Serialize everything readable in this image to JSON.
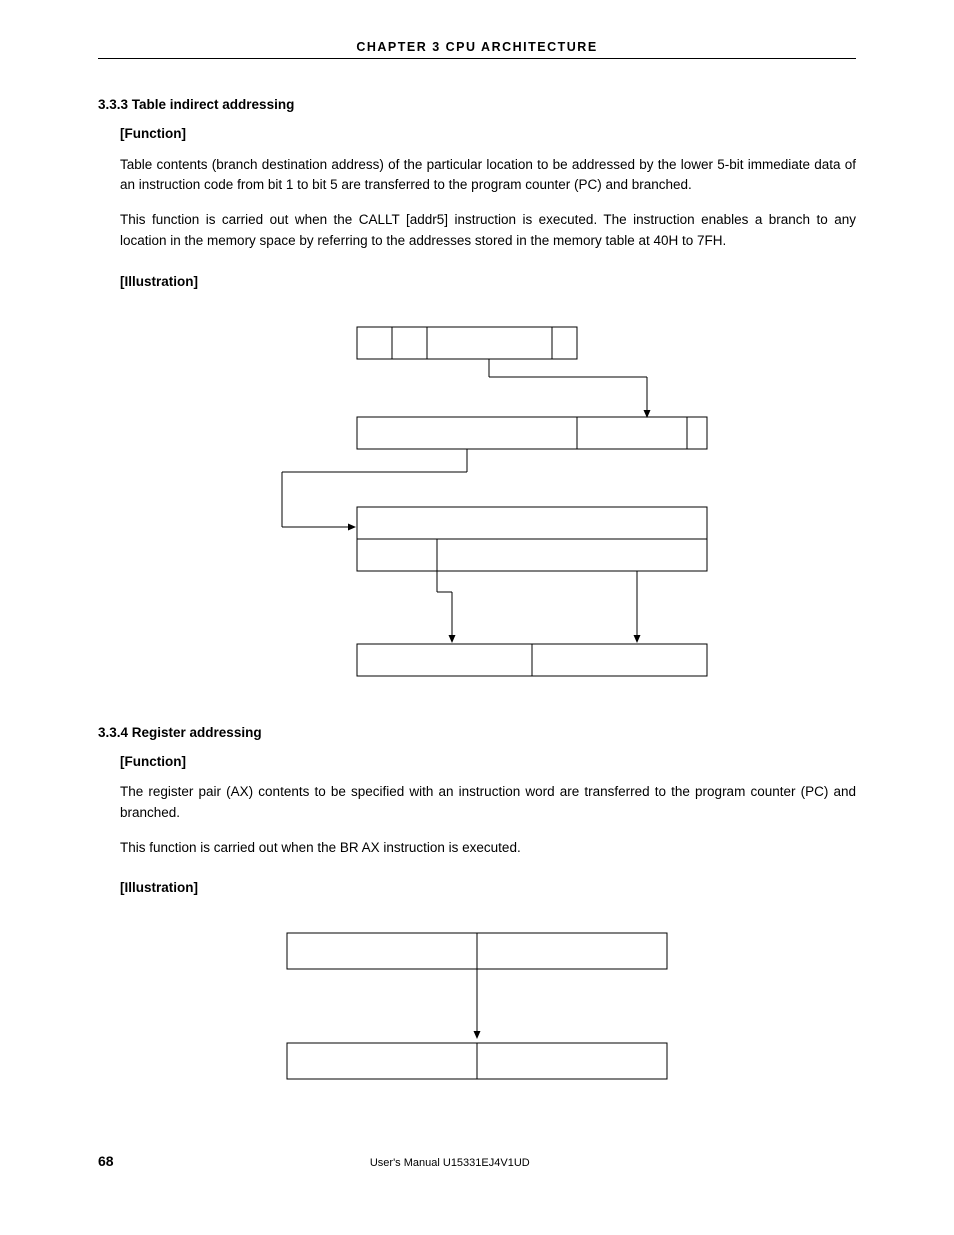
{
  "header": "CHAPTER  3   CPU  ARCHITECTURE",
  "section333": {
    "number_title": "3.3.3  Table indirect addressing",
    "function_label": "[Function]",
    "para1": "Table contents (branch destination address) of the particular location to be addressed by the lower 5-bit immediate data of an instruction code from bit 1 to bit 5 are transferred to the program counter (PC) and branched.",
    "para2": "This function is carried out when the CALLT [addr5] instruction is executed.  The instruction enables a branch to any location in the memory space by referring to the addresses stored in the memory table at 40H to 7FH.",
    "illustration_label": "[Illustration]"
  },
  "section334": {
    "number_title": "3.3.4  Register addressing",
    "function_label": "[Function]",
    "para1": "The register pair (AX) contents to be specified with an instruction word are transferred to the program counter (PC) and branched.",
    "para2": "This function is carried out when the BR AX instruction is executed.",
    "illustration_label": "[Illustration]"
  },
  "footer": {
    "page_number": "68",
    "doc_id": "User's Manual  U15331EJ4V1UD"
  }
}
